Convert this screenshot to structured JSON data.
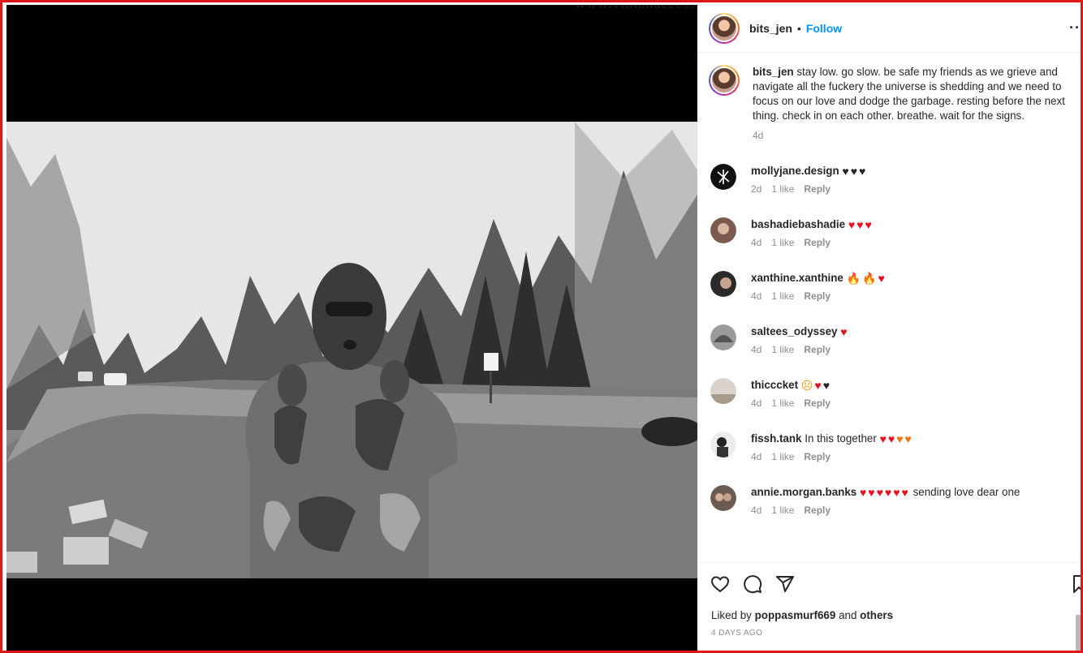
{
  "post": {
    "author": "bits_jen",
    "separator": "•",
    "follow_label": "Follow",
    "more_label": "...",
    "watermark": "www.vintanaccess.com/link_in_bio",
    "caption": "stay low. go slow. be safe my friends as we grieve and navigate all the fuckery the universe is shedding and we need to focus on our love and dodge the garbage. resting before the next thing. check in on each other. breathe. wait for the signs.",
    "caption_age": "4d"
  },
  "comments": [
    {
      "user": "mollyjane.design",
      "text": "",
      "emoji": [
        "black-heart",
        "black-heart",
        "black-heart"
      ],
      "age": "2d",
      "likes": "1 like",
      "reply": "Reply"
    },
    {
      "user": "bashadiebashadie",
      "text": "",
      "emoji": [
        "red-heart",
        "red-heart",
        "red-heart"
      ],
      "age": "4d",
      "likes": "1 like",
      "reply": "Reply"
    },
    {
      "user": "xanthine.xanthine",
      "text": "",
      "emoji": [
        "fire",
        "fire",
        "red-heart"
      ],
      "age": "4d",
      "likes": "1 like",
      "reply": "Reply"
    },
    {
      "user": "saltees_odyssey",
      "text": "",
      "emoji": [
        "red-heart"
      ],
      "age": "4d",
      "likes": "1 like",
      "reply": "Reply"
    },
    {
      "user": "thicccket",
      "text": "",
      "emoji": [
        "sad-face",
        "red-heart",
        "black-heart"
      ],
      "age": "4d",
      "likes": "1 like",
      "reply": "Reply"
    },
    {
      "user": "fissh.tank",
      "text": "In this together",
      "emoji": [
        "broken-heart",
        "broken-heart",
        "orange-heart",
        "orange-heart"
      ],
      "age": "4d",
      "likes": "1 like",
      "reply": "Reply"
    },
    {
      "user": "annie.morgan.banks",
      "text": "sending love dear one",
      "emoji": [
        "red-heart",
        "red-heart",
        "red-heart",
        "broken-heart",
        "broken-heart",
        "broken-heart"
      ],
      "age": "4d",
      "likes": "1 like",
      "reply": "Reply"
    }
  ],
  "footer": {
    "liked_by_prefix": "Liked by",
    "liked_by_user": "poppasmurf669",
    "liked_by_and": "and",
    "liked_by_others": "others",
    "date": "4 DAYS AGO"
  },
  "icons": [
    "heart-icon",
    "comment-icon",
    "share-icon",
    "bookmark-icon"
  ],
  "colors": {
    "accent": "#0095f6",
    "frame": "#e0161b",
    "heart_red": "#e8101f",
    "heart_orange": "#f6710c"
  }
}
